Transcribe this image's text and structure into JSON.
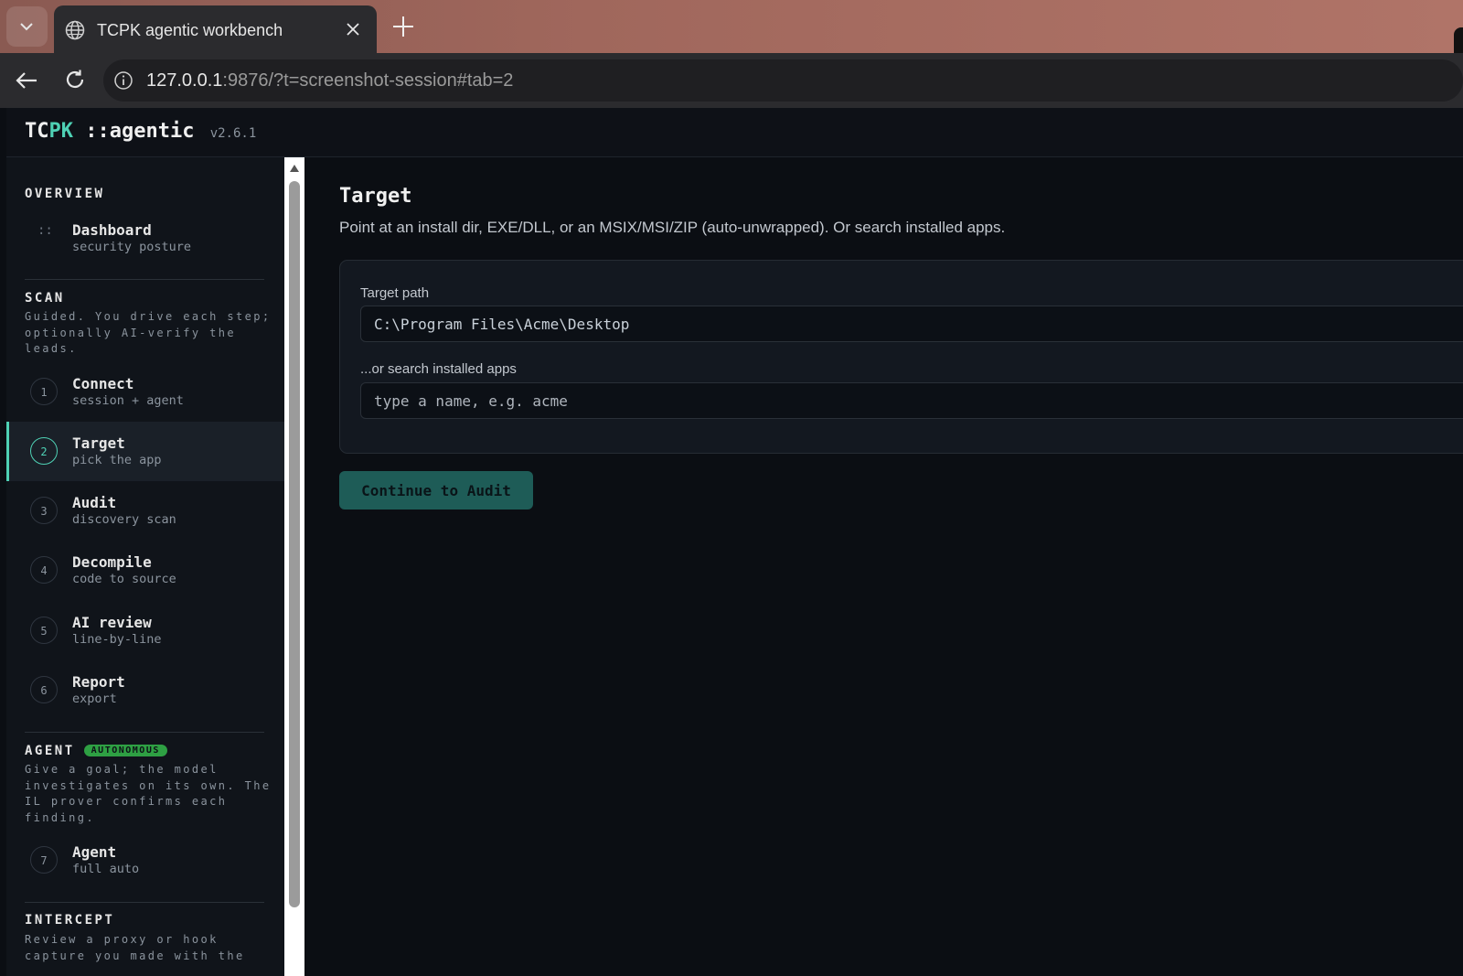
{
  "browser": {
    "tab_title": "TCPK agentic workbench",
    "url_host": "127.0.0.1",
    "url_rest": ":9876/?t=screenshot-session#tab=2"
  },
  "app": {
    "brand_tc": "TC",
    "brand_pk": "PK",
    "brand_rest": " ::agentic",
    "version": "v2.6.1"
  },
  "sidebar": {
    "overview": {
      "title": "OVERVIEW",
      "items": [
        {
          "icon": "::",
          "label": "Dashboard",
          "sub": "security posture"
        }
      ]
    },
    "scan": {
      "title": "SCAN",
      "desc": "Guided. You drive each step; optionally AI-verify the leads.",
      "items": [
        {
          "num": "1",
          "label": "Connect",
          "sub": "session + agent"
        },
        {
          "num": "2",
          "label": "Target",
          "sub": "pick the app",
          "active": true
        },
        {
          "num": "3",
          "label": "Audit",
          "sub": "discovery scan"
        },
        {
          "num": "4",
          "label": "Decompile",
          "sub": "code to source"
        },
        {
          "num": "5",
          "label": "AI review",
          "sub": "line-by-line"
        },
        {
          "num": "6",
          "label": "Report",
          "sub": "export"
        }
      ]
    },
    "agent": {
      "title": "AGENT",
      "badge": "AUTONOMOUS",
      "desc": "Give a goal; the model investigates on its own. The IL prover confirms each finding.",
      "items": [
        {
          "num": "7",
          "label": "Agent",
          "sub": "full auto"
        }
      ]
    },
    "intercept": {
      "title": "INTERCEPT",
      "desc": "Review a proxy or hook capture you made with the"
    }
  },
  "main": {
    "title": "Target",
    "description": "Point at an install dir, EXE/DLL, or an MSIX/MSI/ZIP (auto-unwrapped). Or search installed apps.",
    "target_path_label": "Target path",
    "target_path_value": "C:\\Program Files\\Acme\\Desktop",
    "search_label": "...or search installed apps",
    "search_placeholder": "type a name, e.g. acme",
    "continue_button": "Continue to Audit"
  },
  "colors": {
    "accent": "#4fd1b5",
    "button_bg": "#1e5c57",
    "badge_bg": "#2ea043"
  }
}
